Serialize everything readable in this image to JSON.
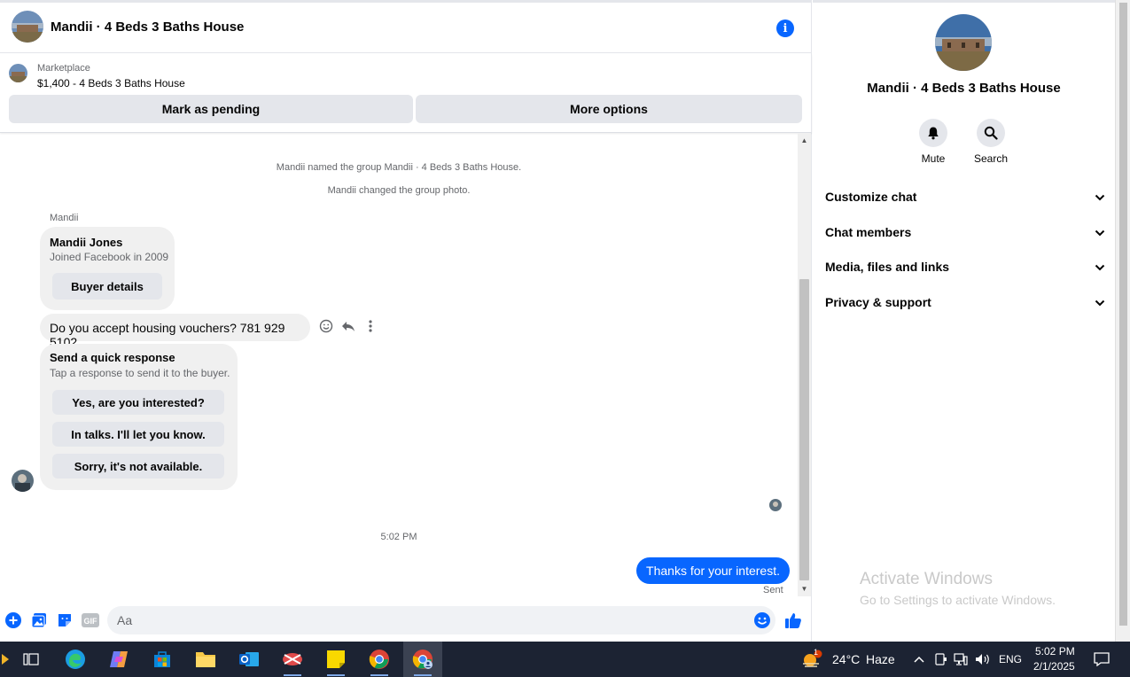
{
  "header": {
    "title": "Mandii · 4 Beds 3 Baths House",
    "info_icon": "info-icon"
  },
  "marketplace": {
    "label": "Marketplace",
    "listing": "$1,400 - 4 Beds 3 Baths House",
    "mark_pending": "Mark as pending",
    "more_options": "More options"
  },
  "thread": {
    "system_messages": [
      "Mandii named the group Mandii · 4 Beds 3 Baths House.",
      "Mandii changed the group photo."
    ],
    "sender": "Mandii",
    "profile_card": {
      "name": "Mandii Jones",
      "joined": "Joined Facebook in 2009",
      "button": "Buyer details"
    },
    "message": "Do you accept housing vouchers? 781 929 5102",
    "quick_response": {
      "title": "Send a quick response",
      "subtitle": "Tap a response to send it to the buyer.",
      "options": [
        "Yes, are you interested?",
        "In talks. I'll let you know.",
        "Sorry, it's not available."
      ]
    },
    "timestamp": "5:02 PM",
    "outgoing": "Thanks for your interest.",
    "status": "Sent"
  },
  "composer": {
    "placeholder": "Aa"
  },
  "right_panel": {
    "title": "Mandii · 4 Beds 3 Baths House",
    "actions": [
      {
        "label": "Mute",
        "icon": "bell-icon"
      },
      {
        "label": "Search",
        "icon": "search-icon"
      }
    ],
    "sections": [
      "Customize chat",
      "Chat members",
      "Media, files and links",
      "Privacy & support"
    ]
  },
  "watermark": {
    "line1": "Activate Windows",
    "line2": "Go to Settings to activate Windows."
  },
  "taskbar": {
    "weather_temp": "24°C",
    "weather_desc": "Haze",
    "weather_badge": "1",
    "language": "ENG",
    "time": "5:02 PM",
    "date": "2/1/2025"
  },
  "colors": {
    "accent": "#0866ff",
    "bubble_gray": "#f0f0f0",
    "taskbar": "#1c2333"
  }
}
